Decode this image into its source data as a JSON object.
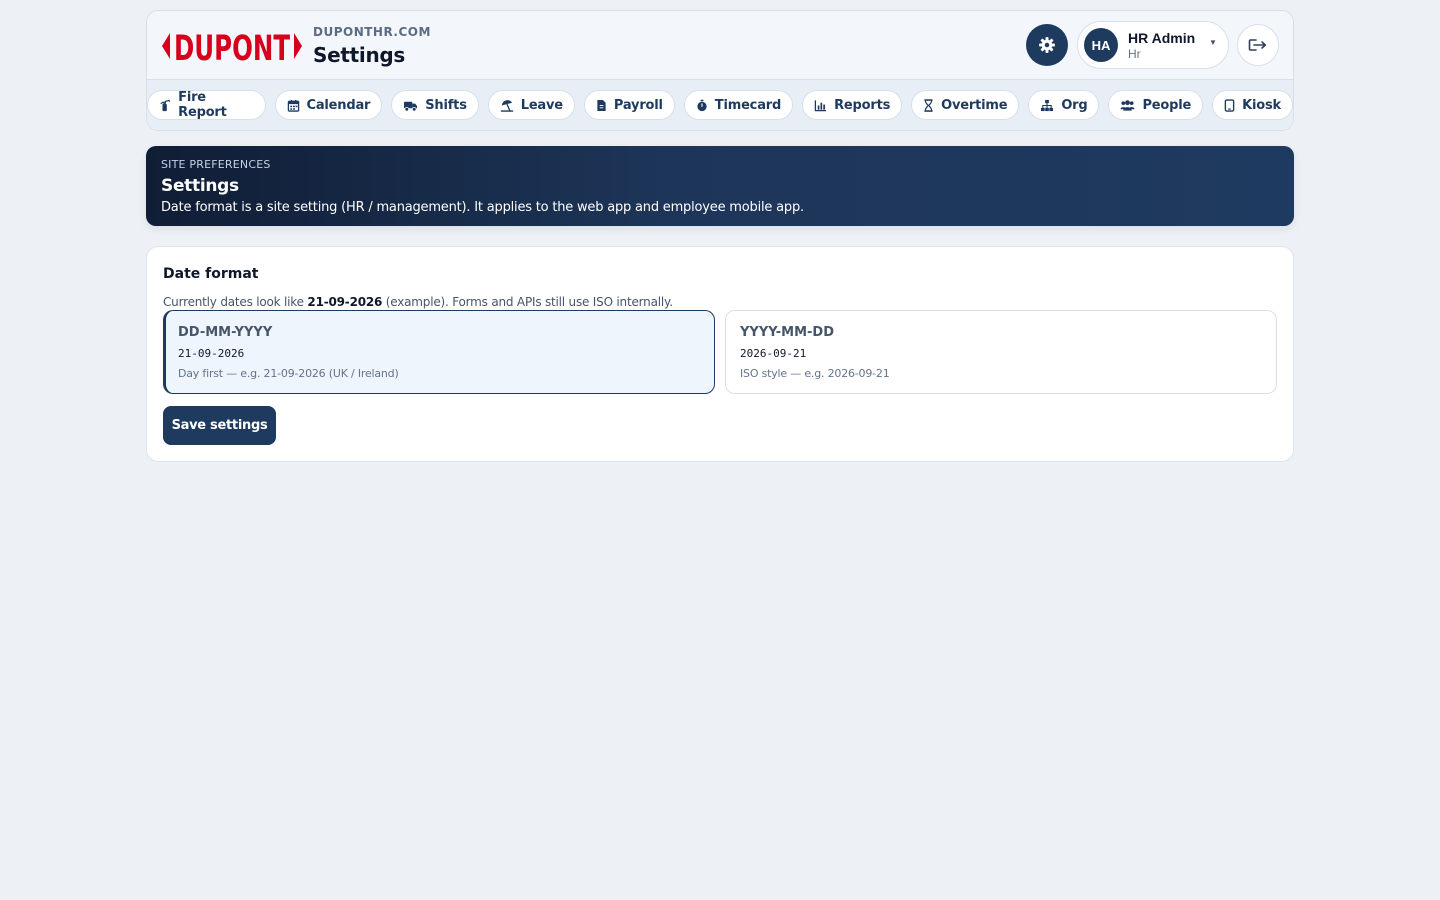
{
  "header": {
    "brand": "DUPONT",
    "site_domain": "DUPONTHR.COM",
    "page_title": "Settings",
    "brand_color": "#d6001c",
    "accent_color": "#1e3a5f"
  },
  "user": {
    "initials": "HA",
    "name": "HR Admin",
    "role": "Hr"
  },
  "nav": {
    "items": [
      {
        "label": "Fire Report",
        "icon": "fire-extinguisher-icon"
      },
      {
        "label": "Calendar",
        "icon": "calendar-icon"
      },
      {
        "label": "Shifts",
        "icon": "truck-icon"
      },
      {
        "label": "Leave",
        "icon": "umbrella-beach-icon"
      },
      {
        "label": "Payroll",
        "icon": "receipt-icon"
      },
      {
        "label": "Timecard",
        "icon": "stopwatch-icon"
      },
      {
        "label": "Reports",
        "icon": "bar-chart-icon"
      },
      {
        "label": "Overtime",
        "icon": "hourglass-icon"
      },
      {
        "label": "Org",
        "icon": "sitemap-icon"
      },
      {
        "label": "People",
        "icon": "users-icon"
      },
      {
        "label": "Kiosk",
        "icon": "tablet-icon"
      }
    ]
  },
  "hero": {
    "kicker": "SITE PREFERENCES",
    "title": "Settings",
    "description": "Date format is a site setting (HR / management). It applies to the web app and employee mobile app."
  },
  "date_format": {
    "title": "Date format",
    "note_prefix": "Currently dates look like ",
    "note_example": "21-09-2026",
    "note_suffix": " (example). Forms and APIs still use ISO internally.",
    "options": [
      {
        "label": "DD-MM-YYYY",
        "sample": "21-09-2026",
        "description": "Day first — e.g. 21-09-2026 (UK / Ireland)",
        "selected": true
      },
      {
        "label": "YYYY-MM-DD",
        "sample": "2026-09-21",
        "description": "ISO style — e.g. 2026-09-21",
        "selected": false
      }
    ],
    "save_label": "Save settings"
  }
}
